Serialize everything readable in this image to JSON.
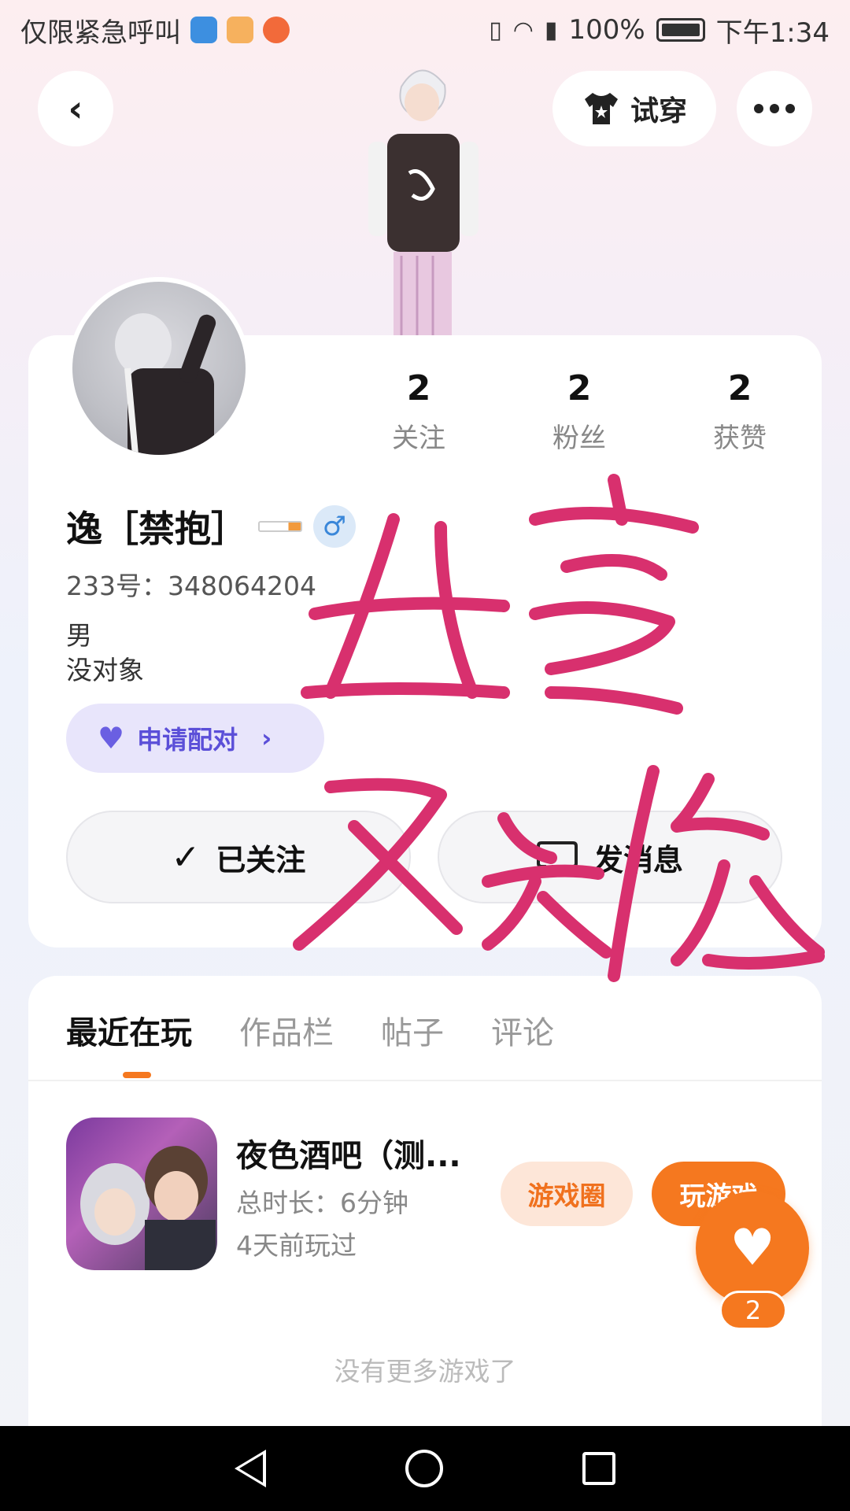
{
  "status_bar": {
    "carrier_text": "仅限紧急呼叫",
    "battery_text": "100%",
    "time": "下午1:34"
  },
  "top_bar": {
    "try_on_label": "试穿"
  },
  "profile": {
    "name": "逸［禁抱］",
    "gender_symbol": "♂",
    "uid_label": "233号：348064204",
    "bio_line1": "男",
    "bio_line2": "没对象",
    "stats": [
      {
        "value": "2",
        "label": "关注"
      },
      {
        "value": "2",
        "label": "粉丝"
      },
      {
        "value": "2",
        "label": "获赞"
      }
    ],
    "match_button": "申请配对",
    "follow_button": "已关注",
    "message_button": "发消息"
  },
  "tabs": [
    {
      "label": "最近在玩",
      "active": true
    },
    {
      "label": "作品栏",
      "active": false
    },
    {
      "label": "帖子",
      "active": false
    },
    {
      "label": "评论",
      "active": false
    }
  ],
  "recent_game": {
    "title": "夜色酒吧（测...",
    "duration": "总时长：6分钟",
    "last_played": "4天前玩过",
    "circle_button": "游戏圈",
    "play_button": "玩游戏"
  },
  "like_fab": {
    "count": "2"
  },
  "footer_text": "没有更多游戏了",
  "colors": {
    "accent_orange": "#f5781f",
    "match_purple": "#5b4fd8",
    "scribble_pink": "#d8306e"
  },
  "icons": [
    "back-icon",
    "shirt-icon",
    "more-icon",
    "check-icon",
    "message-icon",
    "heart-icon"
  ]
}
